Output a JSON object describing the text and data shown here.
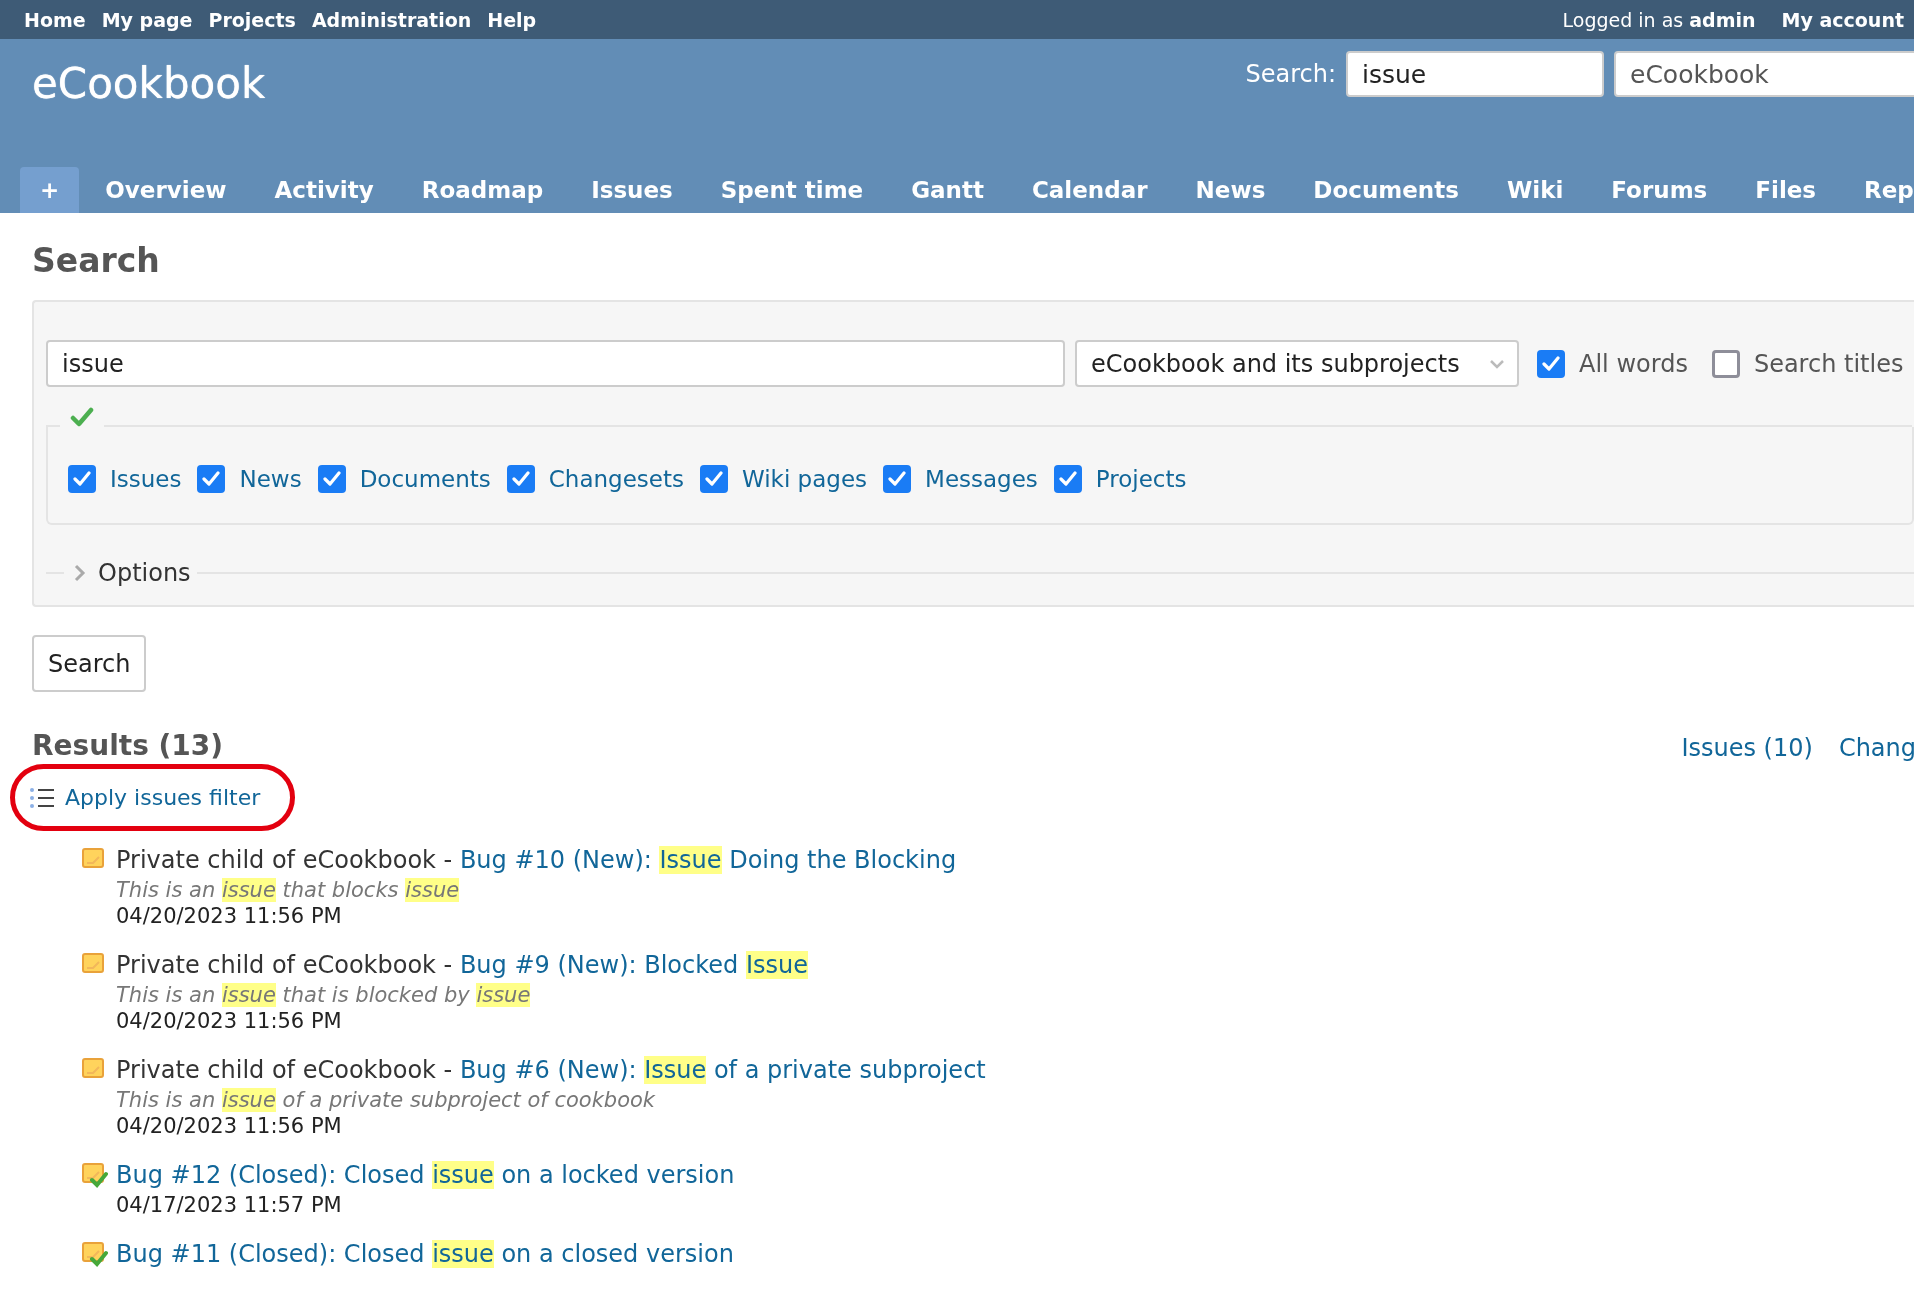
{
  "top_menu": [
    {
      "label": "Home"
    },
    {
      "label": "My page"
    },
    {
      "label": "Projects"
    },
    {
      "label": "Administration"
    },
    {
      "label": "Help"
    }
  ],
  "account": {
    "prefix": "Logged in as",
    "user": "admin",
    "link": "My account"
  },
  "header": {
    "title": "eCookbook",
    "search_label": "Search:",
    "search_value": "issue",
    "project_value": "eCookbook"
  },
  "tabs": [
    {
      "label": "+",
      "kind": "add"
    },
    {
      "label": "Overview",
      "kind": "link"
    },
    {
      "label": "Activity",
      "kind": "link"
    },
    {
      "label": "Roadmap",
      "kind": "link"
    },
    {
      "label": "Issues",
      "kind": "link"
    },
    {
      "label": "Spent time",
      "kind": "link"
    },
    {
      "label": "Gantt",
      "kind": "link"
    },
    {
      "label": "Calendar",
      "kind": "link"
    },
    {
      "label": "News",
      "kind": "link"
    },
    {
      "label": "Documents",
      "kind": "link"
    },
    {
      "label": "Wiki",
      "kind": "link"
    },
    {
      "label": "Forums",
      "kind": "link"
    },
    {
      "label": "Files",
      "kind": "link"
    },
    {
      "label": "Rep",
      "kind": "link"
    }
  ],
  "page_title": "Search",
  "search_form": {
    "query": "issue",
    "scope": "eCookbook and its subprojects",
    "all_words": {
      "label": "All words",
      "checked": true
    },
    "titles_only": {
      "label": "Search titles",
      "checked": false
    },
    "types": [
      {
        "label": "Issues",
        "checked": true
      },
      {
        "label": "News",
        "checked": true
      },
      {
        "label": "Documents",
        "checked": true
      },
      {
        "label": "Changesets",
        "checked": true
      },
      {
        "label": "Wiki pages",
        "checked": true
      },
      {
        "label": "Messages",
        "checked": true
      },
      {
        "label": "Projects",
        "checked": true
      }
    ],
    "options": {
      "label": "Options",
      "expanded": false
    },
    "button": "Search"
  },
  "results": {
    "heading": "Results (13)",
    "type_links": [
      {
        "label": "Issues (10)"
      },
      {
        "label": "Chang"
      }
    ],
    "filter_link": {
      "label": "Apply issues filter",
      "circled": true
    },
    "items": [
      {
        "kind": "open",
        "project": "Private child of eCookbook - ",
        "title": [
          {
            "text": "Bug #10 (New): ",
            "highlight": false
          },
          {
            "text": "Issue",
            "highlight": true
          },
          {
            "text": " Doing the Blocking",
            "highlight": false
          }
        ],
        "description": [
          {
            "text": "This is an ",
            "highlight": false
          },
          {
            "text": "issue",
            "highlight": true
          },
          {
            "text": " that blocks ",
            "highlight": false
          },
          {
            "text": "issue",
            "highlight": true
          }
        ],
        "date": "04/20/2023 11:56 PM"
      },
      {
        "kind": "open",
        "project": "Private child of eCookbook - ",
        "title": [
          {
            "text": "Bug #9 (New): Blocked ",
            "highlight": false
          },
          {
            "text": "Issue",
            "highlight": true
          }
        ],
        "description": [
          {
            "text": "This is an ",
            "highlight": false
          },
          {
            "text": "issue",
            "highlight": true
          },
          {
            "text": " that is blocked by ",
            "highlight": false
          },
          {
            "text": "issue",
            "highlight": true
          }
        ],
        "date": "04/20/2023 11:56 PM"
      },
      {
        "kind": "open",
        "project": "Private child of eCookbook - ",
        "title": [
          {
            "text": "Bug #6 (New): ",
            "highlight": false
          },
          {
            "text": "Issue",
            "highlight": true
          },
          {
            "text": " of a private subproject",
            "highlight": false
          }
        ],
        "description": [
          {
            "text": "This is an ",
            "highlight": false
          },
          {
            "text": "issue",
            "highlight": true
          },
          {
            "text": " of a private subproject of cookbook",
            "highlight": false
          }
        ],
        "date": "04/20/2023 11:56 PM"
      },
      {
        "kind": "closed",
        "title": [
          {
            "text": "Bug #12 (Closed): Closed ",
            "highlight": false
          },
          {
            "text": "issue",
            "highlight": true
          },
          {
            "text": " on a locked version",
            "highlight": false
          }
        ],
        "date": "04/17/2023 11:57 PM"
      },
      {
        "kind": "closed",
        "title": [
          {
            "text": "Bug #11 (Closed): Closed ",
            "highlight": false
          },
          {
            "text": "issue",
            "highlight": true
          },
          {
            "text": " on a closed version",
            "highlight": false
          }
        ]
      }
    ]
  }
}
